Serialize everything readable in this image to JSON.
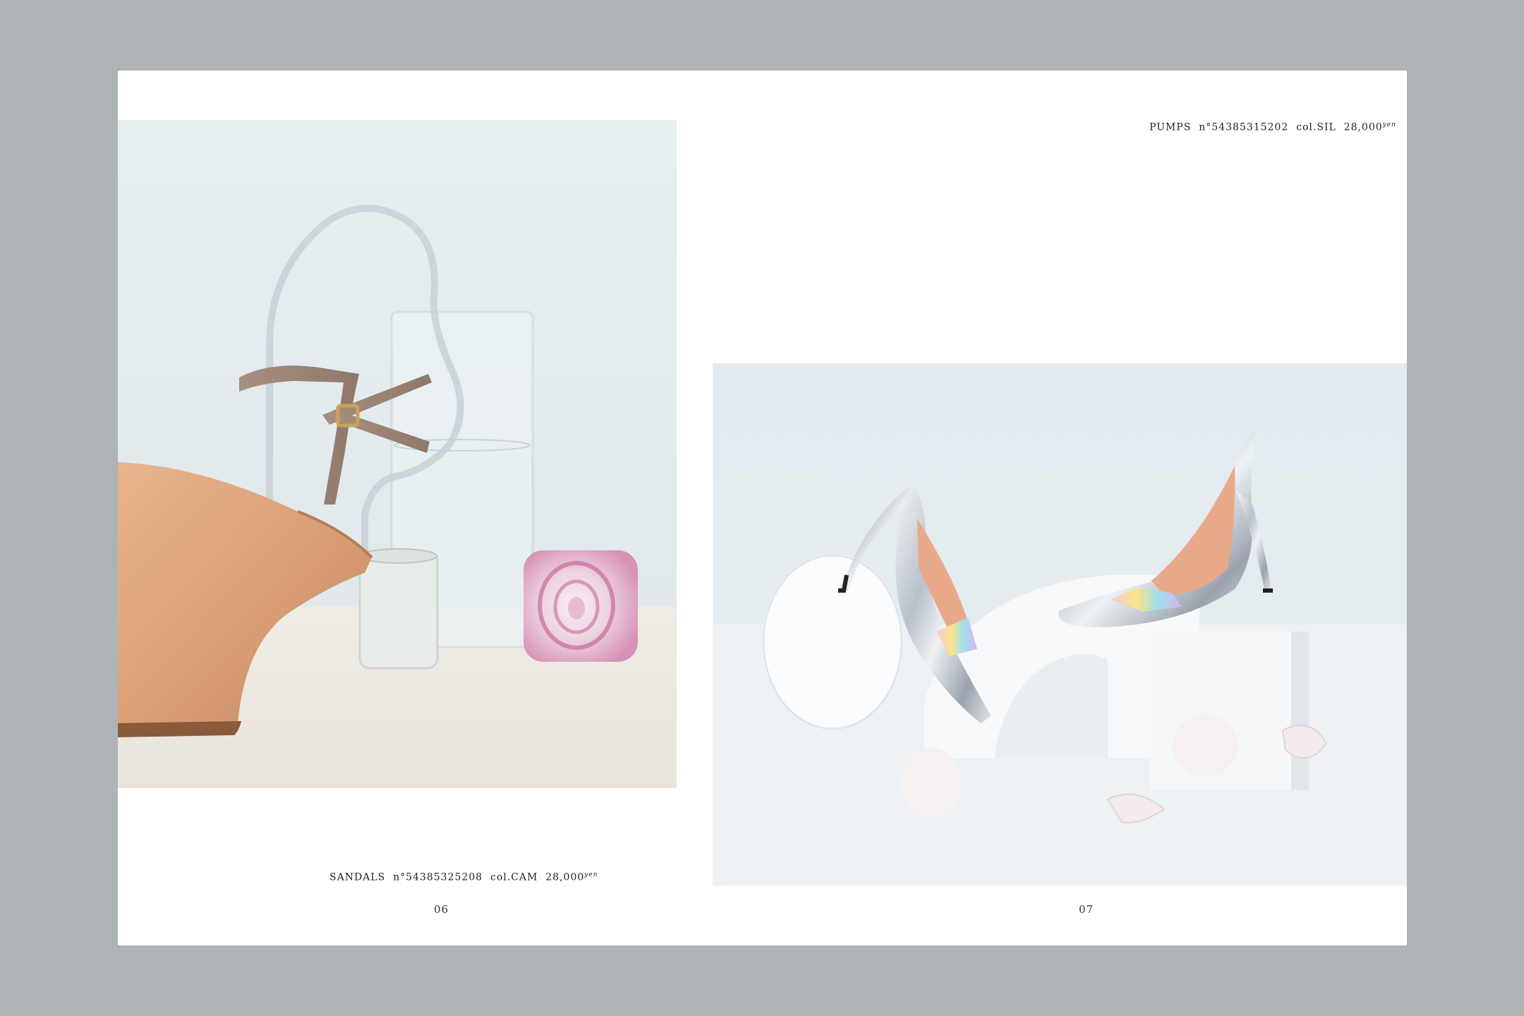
{
  "spread": {
    "left_page": {
      "caption": {
        "category": "SANDALS",
        "number": "n°54385325208",
        "color": "col.CAM",
        "price": "28,000",
        "currency": "yen"
      },
      "folio": "06"
    },
    "right_page": {
      "caption": {
        "category": "PUMPS",
        "number": "n°54385315202",
        "color": "col.SIL",
        "price": "28,000",
        "currency": "yen"
      },
      "folio": "07"
    }
  },
  "colors": {
    "background": "#aeb3b5",
    "page": "#ffffff"
  }
}
